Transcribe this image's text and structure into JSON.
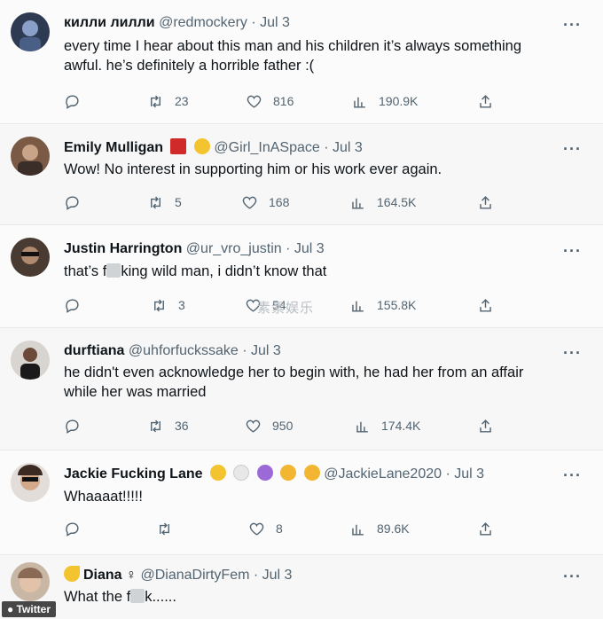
{
  "tweets": [
    {
      "name": "килли лилли",
      "handle": "@redmockery",
      "date": "Jul 3",
      "line1": "every time I hear about this man and his children it’s always something",
      "line2": "awful. he’s definitely a horrible father :(",
      "retweets": "23",
      "likes": "816",
      "views": "190.9K"
    },
    {
      "name": "Emily Mulligan",
      "handle": "@Girl_InASpace",
      "date": "Jul 3",
      "line1": "Wow! No interest in supporting him or his work ever again.",
      "retweets": "5",
      "likes": "168",
      "views": "164.5K"
    },
    {
      "name": "Justin Harrington",
      "handle": "@ur_vro_justin",
      "date": "Jul 3",
      "line1_pre": "that’s f",
      "line1_post": "king wild man, i didn’t know that",
      "retweets": "3",
      "likes": "54",
      "views": "155.8K"
    },
    {
      "name": "durftiana",
      "handle": "@uhforfuckssake",
      "date": "Jul 3",
      "line1": "he didn't even acknowledge her to begin with, he had her from an affair",
      "line2": "while her was married",
      "retweets": "36",
      "likes": "950",
      "views": "174.4K"
    },
    {
      "name": "Jackie Fucking Lane",
      "handle": "@JackieLane2020",
      "date": "Jul 3",
      "line1": "Whaaaat!!!!!",
      "retweets": "",
      "likes": "8",
      "views": "89.6K"
    },
    {
      "name": "Diana",
      "symbol": "♀",
      "handle": "@DianaDirtyFem",
      "date": "Jul 3",
      "line1_pre": "What the f",
      "line1_post": "k......"
    }
  ],
  "separator": "·",
  "more": "···",
  "watermark": "素素娱乐",
  "credit": "● Twitter",
  "colors": {
    "text": "#0f1419",
    "secondary": "#536471",
    "background": "#fbfbfb"
  }
}
